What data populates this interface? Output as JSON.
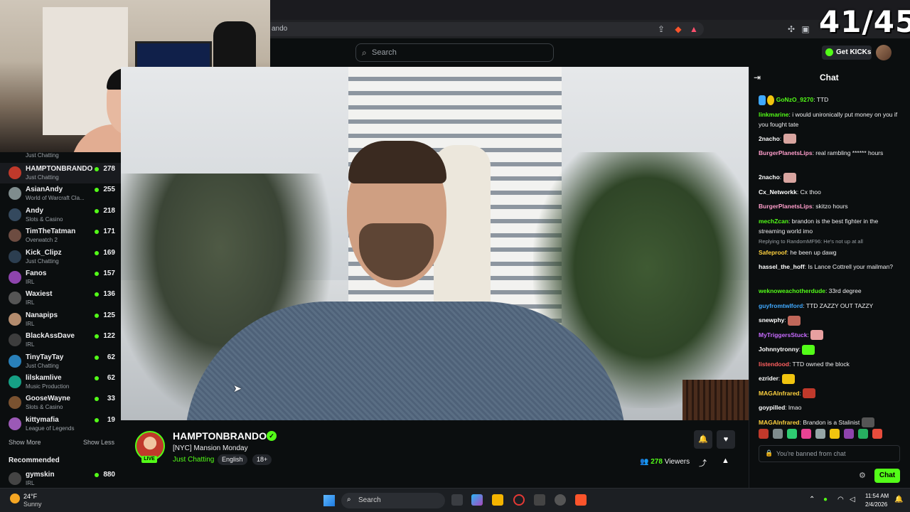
{
  "overlay": {
    "counter": "41/45"
  },
  "browser": {
    "url_fragment": "ando"
  },
  "header": {
    "search_placeholder": "Search",
    "get_kicks_label": "Get KICKs"
  },
  "sidebar": {
    "top_category": "Just Chatting",
    "channels": [
      {
        "name": "HAMPTONBRANDO",
        "category": "Just Chatting",
        "viewers": "278",
        "active": true,
        "color": "#c0392b"
      },
      {
        "name": "AsianAndy",
        "category": "World of Warcraft Cla...",
        "viewers": "255",
        "color": "#7f8c8d"
      },
      {
        "name": "Andy",
        "category": "Slots & Casino",
        "viewers": "218",
        "color": "#34495e"
      },
      {
        "name": "TimTheTatman",
        "category": "Overwatch 2",
        "viewers": "171",
        "color": "#6d4c41"
      },
      {
        "name": "Kick_Clipz",
        "category": "Just Chatting",
        "viewers": "169",
        "color": "#2c3e50"
      },
      {
        "name": "Fanos",
        "category": "IRL",
        "viewers": "157",
        "color": "#8e44ad"
      },
      {
        "name": "Waxiest",
        "category": "IRL",
        "viewers": "136",
        "color": "#555"
      },
      {
        "name": "Nanapips",
        "category": "IRL",
        "viewers": "125",
        "color": "#b38b6d"
      },
      {
        "name": "BlackAssDave",
        "category": "IRL",
        "viewers": "122",
        "color": "#3d3d3d"
      },
      {
        "name": "TinyTayTay",
        "category": "Just Chatting",
        "viewers": "62",
        "color": "#2980b9"
      },
      {
        "name": "lilskamlive",
        "category": "Music Production",
        "viewers": "62",
        "color": "#16a085"
      },
      {
        "name": "GooseWayne",
        "category": "Slots & Casino",
        "viewers": "33",
        "color": "#7a5230"
      },
      {
        "name": "kittymafia",
        "category": "League of Legends",
        "viewers": "19",
        "color": "#9b59b6"
      }
    ],
    "show_more": "Show More",
    "show_less": "Show Less",
    "recommended_label": "Recommended",
    "recommended": [
      {
        "name": "gymskin",
        "category": "IRL",
        "viewers": "880",
        "color": "#444"
      }
    ]
  },
  "stream": {
    "streamer": "HAMPTONBRANDO",
    "live_badge": "LIVE",
    "title": "[NYC] Mansion Monday",
    "category": "Just Chatting",
    "tags": [
      "English",
      "18+"
    ],
    "viewer_count": "278",
    "viewers_label": "Viewers"
  },
  "chat": {
    "title": "Chat",
    "messages": [
      {
        "user": "GoNzO_9270",
        "color": "#53fc18",
        "text": ": TTD",
        "badges": true
      },
      {
        "user": "linkmarine",
        "color": "#53fc18",
        "text": ": i would unironically put money on you if you fought tate"
      },
      {
        "user": "2nacho",
        "color": "#ffffff",
        "text": ":",
        "emote": "#d9a5a0"
      },
      {
        "user": "BurgerPlanetsLips",
        "color": "#ff9ecb",
        "text": ": real rambling ****** hours"
      },
      {
        "user": "2nacho",
        "color": "#ffffff",
        "text": ":",
        "emote": "#d9a5a0"
      },
      {
        "user": "Cx_Networkk",
        "color": "#ffffff",
        "text": ": Cx thoo"
      },
      {
        "user": "BurgerPlanetsLips",
        "color": "#ff9ecb",
        "text": ": skitzo hours"
      },
      {
        "user": "mechZcan",
        "color": "#53fc18",
        "text": ": brandon is the best fighter in the streaming world imo"
      },
      {
        "user": "Safeproof",
        "color": "#ffd23f",
        "text": ": he been up dawg",
        "reply": "Replying to RandomMF96: He's not up at all"
      },
      {
        "user": "hassel_the_hoff",
        "color": "#ffffff",
        "text": ": Is Lance Cottrell your mailman?"
      },
      {
        "user": "weknoweachotherdude",
        "color": "#53fc18",
        "text": ": 33rd degree"
      },
      {
        "user": "guyfromtwlford",
        "color": "#3fa9ff",
        "text": ": TTD ZAZZY OUT TAZZY"
      },
      {
        "user": "snewphy",
        "color": "#ffffff",
        "text": ":",
        "emote": "#c0675a"
      },
      {
        "user": "MyTriggersStuck",
        "color": "#c86bff",
        "text": ":",
        "emote": "#e8a0a0"
      },
      {
        "user": "Johnnytronny",
        "color": "#ffffff",
        "text": ":",
        "emote": "#53fc18"
      },
      {
        "user": "listendood",
        "color": "#ff5f5f",
        "text": ": TTD owned the block"
      },
      {
        "user": "ezrider",
        "color": "#ffffff",
        "text": ":",
        "emote": "#f1c40f"
      },
      {
        "user": "MAGAInfrared",
        "color": "#ffd23f",
        "text": ":",
        "emote": "#c0392b"
      },
      {
        "user": "goypilled",
        "color": "#ffffff",
        "text": ": lmao"
      },
      {
        "user": "MAGAInfrared",
        "color": "#ffd23f",
        "text": ": Brandon is a Stalinist",
        "emote": "#555555"
      }
    ],
    "banned_text": "You're banned from chat",
    "send_label": "Chat"
  },
  "taskbar": {
    "weather_temp": "24°F",
    "weather_desc": "Sunny",
    "search_label": "Search",
    "time": "11:54 AM",
    "date": "2/4/2026"
  }
}
